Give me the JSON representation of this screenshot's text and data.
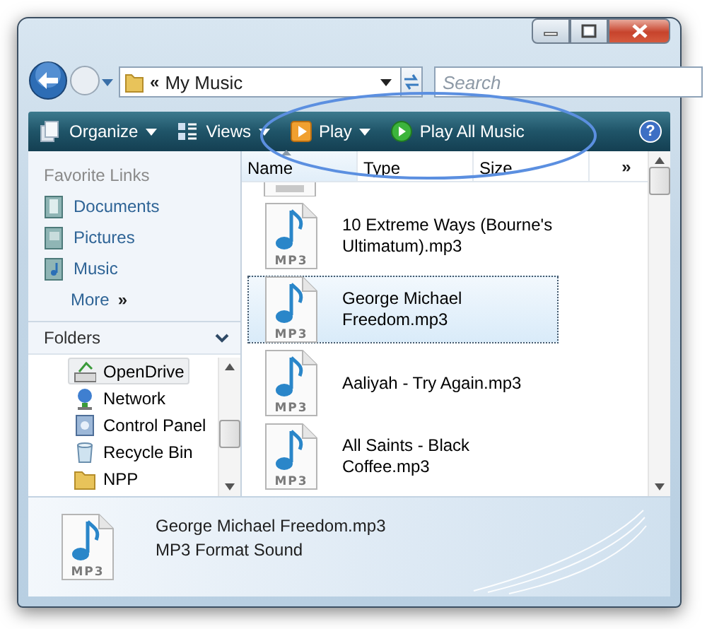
{
  "window": {
    "controls": [
      {
        "kind": "minimize"
      },
      {
        "kind": "maximize"
      },
      {
        "kind": "close"
      }
    ]
  },
  "address": {
    "prefix": "«",
    "path": "My Music"
  },
  "search": {
    "placeholder": "Search"
  },
  "toolbar": [
    {
      "kind": "organize",
      "label": "Organize",
      "dropdown": true
    },
    {
      "kind": "views",
      "label": "Views",
      "dropdown": true
    },
    {
      "kind": "play",
      "label": "Play",
      "dropdown": true
    },
    {
      "kind": "playall",
      "label": "Play All Music",
      "dropdown": false
    }
  ],
  "help": "?",
  "favorite_links": {
    "title": "Favorite Links",
    "items": [
      {
        "kind": "documents",
        "label": "Documents"
      },
      {
        "kind": "pictures",
        "label": "Pictures"
      },
      {
        "kind": "music",
        "label": "Music"
      }
    ],
    "more": {
      "label": "More",
      "arrow": "»"
    }
  },
  "folders": {
    "title": "Folders",
    "items": [
      {
        "kind": "drive",
        "label": "OpenDrive",
        "selected": true
      },
      {
        "kind": "network",
        "label": "Network",
        "selected": false
      },
      {
        "kind": "control",
        "label": "Control Panel",
        "selected": false
      },
      {
        "kind": "recycle",
        "label": "Recycle Bin",
        "selected": false
      },
      {
        "kind": "folder",
        "label": "NPP",
        "selected": false
      }
    ]
  },
  "columns": [
    {
      "label": "Name",
      "sorted": true
    },
    {
      "label": "Type",
      "sorted": false
    },
    {
      "label": "Size",
      "sorted": false
    }
  ],
  "columns_more": "»",
  "files": [
    {
      "name": "10 Extreme Ways (Bourne's Ultimatum).mp3",
      "icon_label": "MP3",
      "selected": false
    },
    {
      "name": "George Michael Freedom.mp3",
      "icon_label": "MP3",
      "selected": true
    },
    {
      "name": "Aaliyah - Try Again.mp3",
      "icon_label": "MP3",
      "selected": false
    },
    {
      "name": "All Saints - Black Coffee.mp3",
      "icon_label": "MP3",
      "selected": false
    }
  ],
  "details": {
    "icon_label": "MP3",
    "name": "George Michael Freedom.mp3",
    "type": "MP3 Format Sound"
  }
}
